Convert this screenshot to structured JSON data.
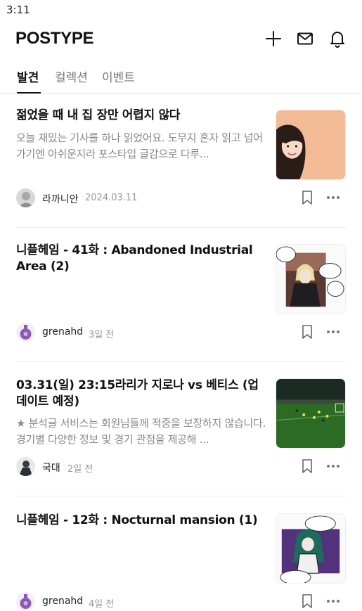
{
  "status_bar": {
    "time": "3:11"
  },
  "header": {
    "logo": "POSTYPE",
    "icons": [
      "plus-icon",
      "mail-icon",
      "bell-icon"
    ]
  },
  "tabs": [
    {
      "label": "발견",
      "active": true
    },
    {
      "label": "컬렉션",
      "active": false
    },
    {
      "label": "이벤트",
      "active": false
    }
  ],
  "posts": [
    {
      "title": "젊었을 때 내 집 장만 어렵지 않다",
      "excerpt": "오늘 재밌는 기사를 하나 읽었어요.  도무지 혼자 읽고 넘어가기엔 아쉬운지라 포스타입 글감으로 다루...",
      "author": "라까니안",
      "date": "2024.03.11"
    },
    {
      "title": "니플헤임 - 41화 : Abandoned Industrial Area (2)",
      "excerpt": "",
      "author": "grenahd",
      "date": "3일 전"
    },
    {
      "title": "03.31(일) 23:15라리가 지로나 vs 베티스 (업데이트 예정)",
      "excerpt": "★ 분석글 서비스는 회원님들께 적중을 보장하지 않습니다. 경기별 다양한 정보 및 경기 관점을 제공해 ...",
      "author": "국대",
      "date": "2일 전"
    },
    {
      "title": "니플헤임 - 12화 : Nocturnal mansion (1)",
      "excerpt": "",
      "author": "grenahd",
      "date": "4일 전"
    }
  ],
  "colors": {
    "text": "#111111",
    "muted": "#888888",
    "divider": "#ececec",
    "accent": "#111111"
  }
}
